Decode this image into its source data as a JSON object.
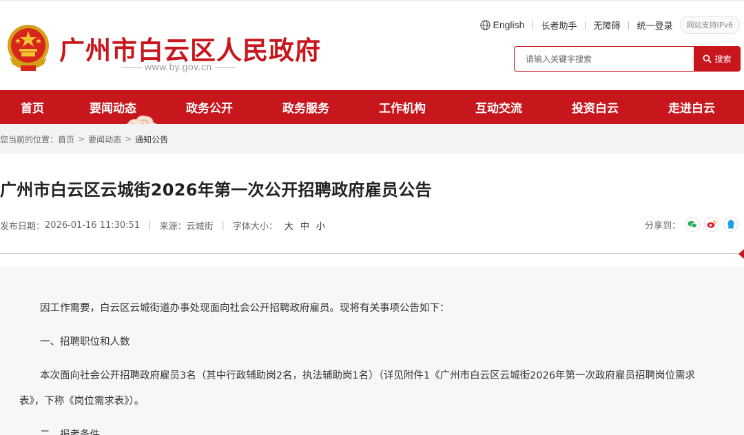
{
  "header": {
    "site_title": "广州市白云区人民政府",
    "site_domain": "www.by.gov.cn",
    "toplinks": [
      "English",
      "长者助手",
      "无障碍",
      "统一登录"
    ],
    "ipv6_label": "网站支持IPv6",
    "search_placeholder": "请输入关键字搜索",
    "search_button": "搜索"
  },
  "nav": {
    "items": [
      "首页",
      "要闻动态",
      "政务公开",
      "政务服务",
      "工作机构",
      "互动交流",
      "投资白云",
      "走进白云"
    ]
  },
  "breadcrumb": {
    "prefix": "您当前的位置：",
    "items": [
      "首页",
      "要闻动态",
      "通知公告"
    ]
  },
  "article": {
    "title": "广州市白云区云城街2026年第一次公开招聘政府雇员公告",
    "publish_label": "发布日期：",
    "publish_date": "2026-01-16 11:30:51",
    "source_label": "来源：",
    "source": "云城街",
    "font_size_label": "字体大小：",
    "font_sizes": [
      "大",
      "中",
      "小"
    ],
    "share_label": "分享到：",
    "paragraphs": [
      "因工作需要，白云区云城街道办事处现面向社会公开招聘政府雇员。现将有关事项公告如下：",
      "一、招聘职位和人数",
      "本次面向社会公开招聘政府雇员3名（其中行政辅助岗2名，执法辅助岗1名）（详见附件1《广州市白云区云城街2026年第一次政府雇员招聘岗位需求",
      "表》，下称《岗位需求表》）。",
      "二、报考条件"
    ]
  },
  "colors": {
    "brand_red": "#c8161d",
    "wechat_green": "#2aae67",
    "weibo_orange": "#e6162d",
    "qq_blue": "#1e9fe6"
  }
}
